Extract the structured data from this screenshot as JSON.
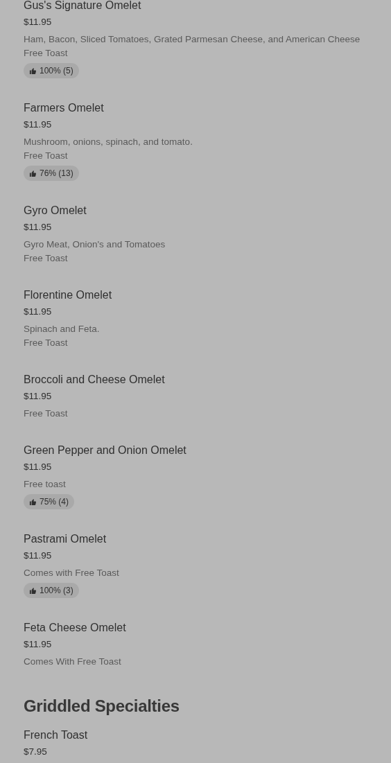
{
  "sections": [
    {
      "items": [
        {
          "name": "Gus's Signature Omelet",
          "price": "$11.95",
          "lines": [
            "Ham, Bacon, Sliced Tomatoes, Grated Parmesan Cheese, and American Cheese",
            "Free Toast"
          ],
          "rating": "100% (5)"
        },
        {
          "name": "Farmers Omelet",
          "price": "$11.95",
          "lines": [
            "Mushroom, onions, spinach, and tomato.",
            "Free Toast"
          ],
          "rating": "76% (13)"
        },
        {
          "name": "Gyro Omelet",
          "price": "$11.95",
          "lines": [
            "Gyro Meat, Onion's and Tomatoes",
            "Free Toast"
          ]
        },
        {
          "name": "Florentine Omelet",
          "price": "$11.95",
          "lines": [
            "Spinach and Feta.",
            "Free Toast"
          ]
        },
        {
          "name": "Broccoli and Cheese Omelet",
          "price": "$11.95",
          "lines": [
            "Free Toast"
          ]
        },
        {
          "name": "Green Pepper and Onion Omelet",
          "price": "$11.95",
          "lines": [
            "Free toast"
          ],
          "rating": "75% (4)"
        },
        {
          "name": "Pastrami Omelet",
          "price": "$11.95",
          "lines": [
            "Comes with Free Toast"
          ],
          "rating": "100% (3)"
        },
        {
          "name": "Feta Cheese Omelet",
          "price": "$11.95",
          "lines": [
            "Comes With Free Toast"
          ]
        }
      ]
    },
    {
      "title": "Griddled Specialties",
      "items": [
        {
          "name": "French Toast",
          "price": "$7.95"
        }
      ]
    }
  ]
}
